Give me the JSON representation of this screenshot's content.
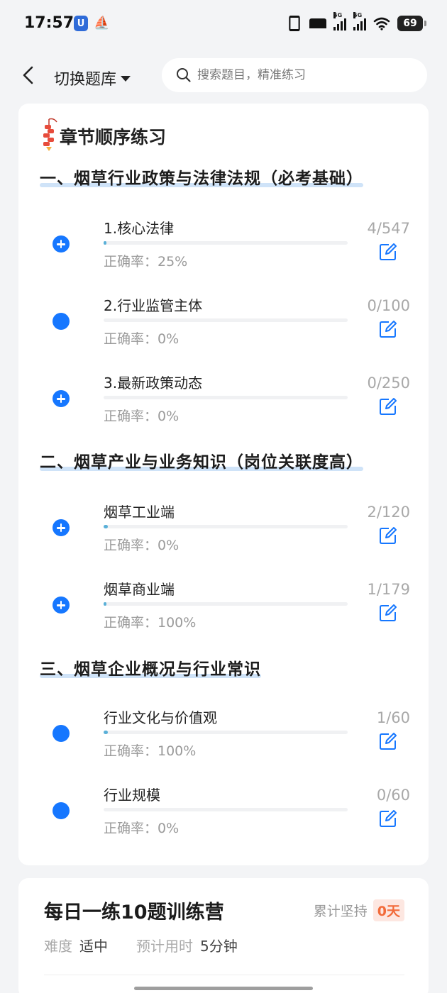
{
  "status_bar": {
    "time": "17:57",
    "network_1": "5G",
    "network_2": "5G",
    "battery": "69"
  },
  "nav": {
    "bank_switch_label": "切换题库",
    "search_placeholder": "搜索题目，精准练习"
  },
  "practice": {
    "title": "章节顺序练习",
    "sections": [
      {
        "heading": "一、烟草行业政策与法律法规（必考基础）",
        "chapters": [
          {
            "name": "1.核心法律",
            "accuracy": "正确率：25%",
            "count": "4/547",
            "progress": 0.0073,
            "expandable": true
          },
          {
            "name": "2.行业监管主体",
            "accuracy": "正确率：0%",
            "count": "0/100",
            "progress": 0,
            "expandable": false
          },
          {
            "name": "3.最新政策动态",
            "accuracy": "正确率：0%",
            "count": "0/250",
            "progress": 0,
            "expandable": true
          }
        ]
      },
      {
        "heading": "二、烟草产业与业务知识（岗位关联度高）",
        "chapters": [
          {
            "name": "烟草工业端",
            "accuracy": "正确率：0%",
            "count": "2/120",
            "progress": 0.0167,
            "expandable": true
          },
          {
            "name": "烟草商业端",
            "accuracy": "正确率：100%",
            "count": "1/179",
            "progress": 0.0056,
            "expandable": true
          }
        ]
      },
      {
        "heading": "三、烟草企业概况与行业常识",
        "chapters": [
          {
            "name": "行业文化与价值观",
            "accuracy": "正确率：100%",
            "count": "1/60",
            "progress": 0.0167,
            "expandable": false
          },
          {
            "name": "行业规模",
            "accuracy": "正确率：0%",
            "count": "0/60",
            "progress": 0,
            "expandable": false
          }
        ]
      }
    ]
  },
  "camp": {
    "title": "每日一练10题训练营",
    "streak_label": "累计坚持",
    "streak_value": "0天",
    "difficulty_label": "难度",
    "difficulty_value": "适中",
    "time_label": "预计用时",
    "time_value": "5分钟"
  },
  "colors": {
    "accent": "#1677ff",
    "progress": "#5ab0d8",
    "streak": "#f26b3a",
    "highlight": "#cfe3f8"
  }
}
